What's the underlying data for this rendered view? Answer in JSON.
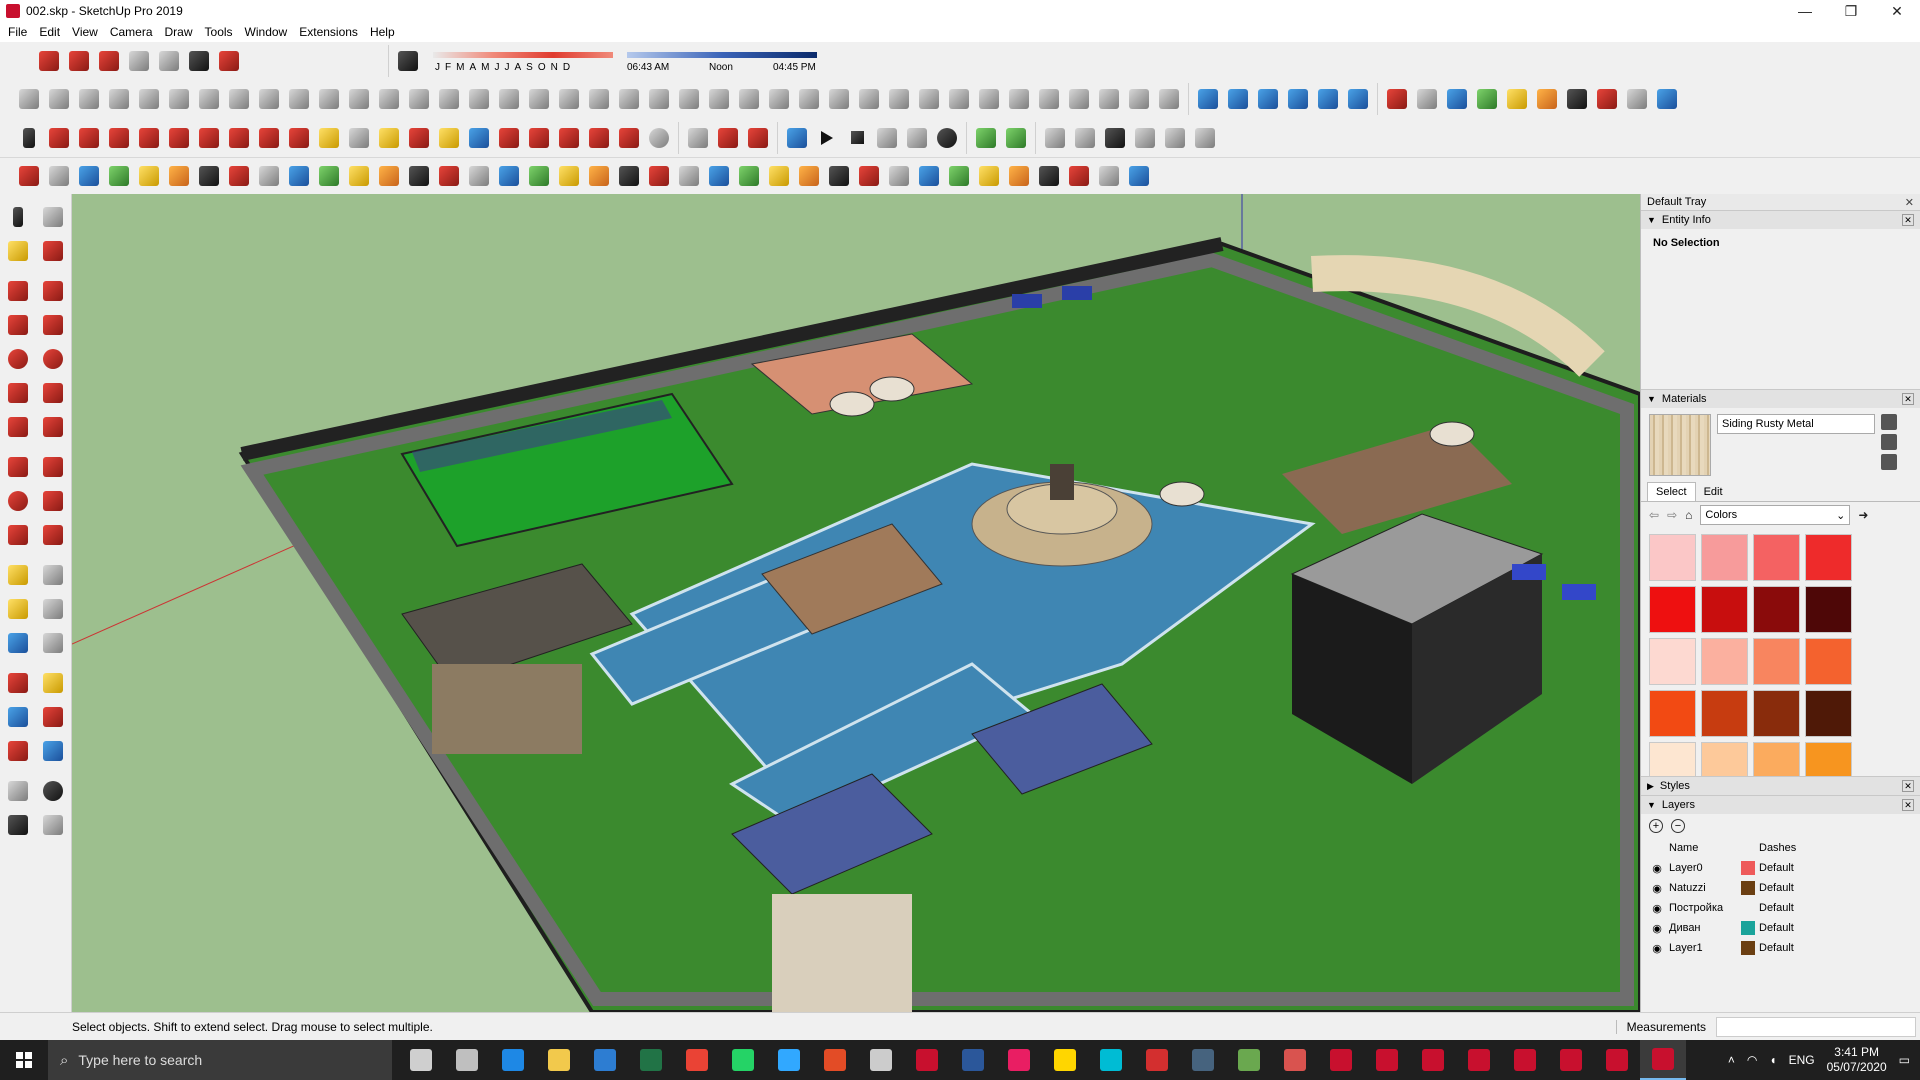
{
  "window": {
    "title": "002.skp - SketchUp Pro 2019",
    "controls": [
      "—",
      "❐",
      "✕"
    ]
  },
  "menu": [
    "File",
    "Edit",
    "View",
    "Camera",
    "Draw",
    "Tools",
    "Window",
    "Extensions",
    "Help"
  ],
  "shadow": {
    "months": [
      "J",
      "F",
      "M",
      "A",
      "M",
      "J",
      "J",
      "A",
      "S",
      "O",
      "N",
      "D"
    ],
    "time_start": "06:43 AM",
    "time_mid": "Noon",
    "time_end": "04:45 PM"
  },
  "tray": {
    "title": "Default Tray",
    "entity_info": {
      "title": "Entity Info",
      "value": "No Selection"
    },
    "materials": {
      "title": "Materials",
      "name": "Siding Rusty Metal",
      "tabs": [
        "Select",
        "Edit"
      ],
      "collection": "Colors",
      "swatches": [
        "#fbc7c7",
        "#f79b9b",
        "#f46262",
        "#ee2b2b",
        "#ee1010",
        "#c80e0e",
        "#8a0b0b",
        "#4e0707",
        "#fdd9d1",
        "#fbb09f",
        "#f8855f",
        "#f4622e",
        "#f24a13",
        "#c73c10",
        "#892c0c",
        "#4f1907",
        "#fde6d1",
        "#fdc99a",
        "#fbab5e",
        "#f7951f"
      ]
    },
    "styles": {
      "title": "Styles"
    },
    "layers": {
      "title": "Layers",
      "col_name": "Name",
      "col_dashes": "Dashes",
      "rows": [
        {
          "name": "Layer0",
          "color": "#ee5a5a",
          "dash": "Default"
        },
        {
          "name": "Natuzzi",
          "color": "#6b3f12",
          "dash": "Default"
        },
        {
          "name": "Постройка",
          "color": "",
          "dash": "Default"
        },
        {
          "name": "Диван",
          "color": "#1aa39a",
          "dash": "Default"
        },
        {
          "name": "Layer1",
          "color": "#6b3f12",
          "dash": "Default"
        }
      ]
    }
  },
  "status": {
    "hint": "Select objects. Shift to extend select. Drag mouse to select multiple.",
    "measurements_label": "Measurements"
  },
  "taskbar": {
    "search_placeholder": "Type here to search",
    "time": "3:41 PM",
    "date": "05/07/2020",
    "lang": "ENG"
  }
}
